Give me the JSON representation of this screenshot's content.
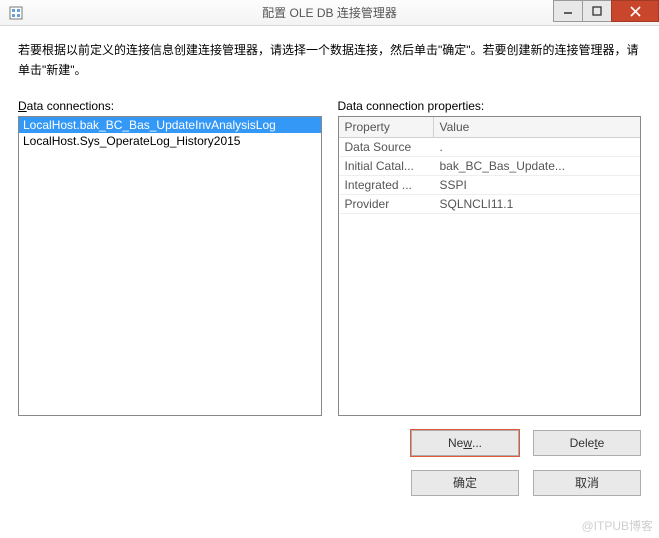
{
  "titlebar": {
    "title": "配置 OLE DB 连接管理器"
  },
  "instructions": "若要根据以前定义的连接信息创建连接管理器，请选择一个数据连接，然后单击\"确定\"。若要创建新的连接管理器，请单击\"新建\"。",
  "left": {
    "label_pre": "D",
    "label_rest": "ata connections:",
    "items": [
      "LocalHost.bak_BC_Bas_UpdateInvAnalysisLog",
      "LocalHost.Sys_OperateLog_History2015"
    ]
  },
  "right": {
    "label": "Data connection properties:",
    "header_prop": "Property",
    "header_val": "Value",
    "rows": [
      {
        "name": "Data Source",
        "value": "."
      },
      {
        "name": "Initial Catal...",
        "value": "bak_BC_Bas_Update..."
      },
      {
        "name": "Integrated ...",
        "value": "SSPI"
      },
      {
        "name": "Provider",
        "value": "SQLNCLI11.1"
      }
    ]
  },
  "buttons": {
    "new_pre": "Ne",
    "new_u": "w",
    "new_post": "...",
    "delete_pre": "Dele",
    "delete_u": "t",
    "delete_post": "e",
    "ok": "确定",
    "cancel": "取消"
  },
  "watermark": "@ITPUB博客"
}
